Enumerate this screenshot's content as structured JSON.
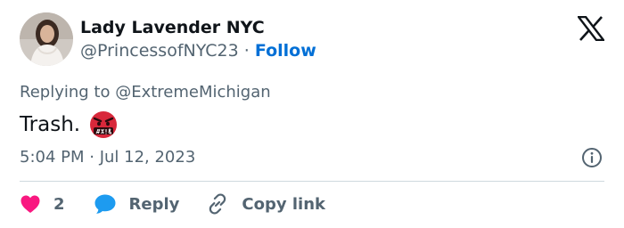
{
  "tweet": {
    "author": {
      "display_name": "Lady Lavender NYC",
      "handle": "@PrincessofNYC23",
      "separator": " · ",
      "follow_label": "Follow"
    },
    "replying_to_prefix": "Replying to ",
    "replying_to_handle": "@ExtremeMichigan",
    "text": "Trash.",
    "emoji": "face-with-symbols-on-mouth",
    "timestamp": "5:04 PM · Jul 12, 2023",
    "actions": {
      "like_count": "2",
      "reply_label": "Reply",
      "copy_link_label": "Copy link"
    }
  },
  "colors": {
    "link": "#006fd6",
    "like": "#f91880",
    "reply": "#1d9bf0",
    "secondary_text": "#536471",
    "primary_text": "#0f1419"
  },
  "icons": {
    "logo": "x-logo-icon",
    "info": "info-icon",
    "like": "heart-icon",
    "reply": "speech-bubble-icon",
    "copy": "link-icon"
  }
}
